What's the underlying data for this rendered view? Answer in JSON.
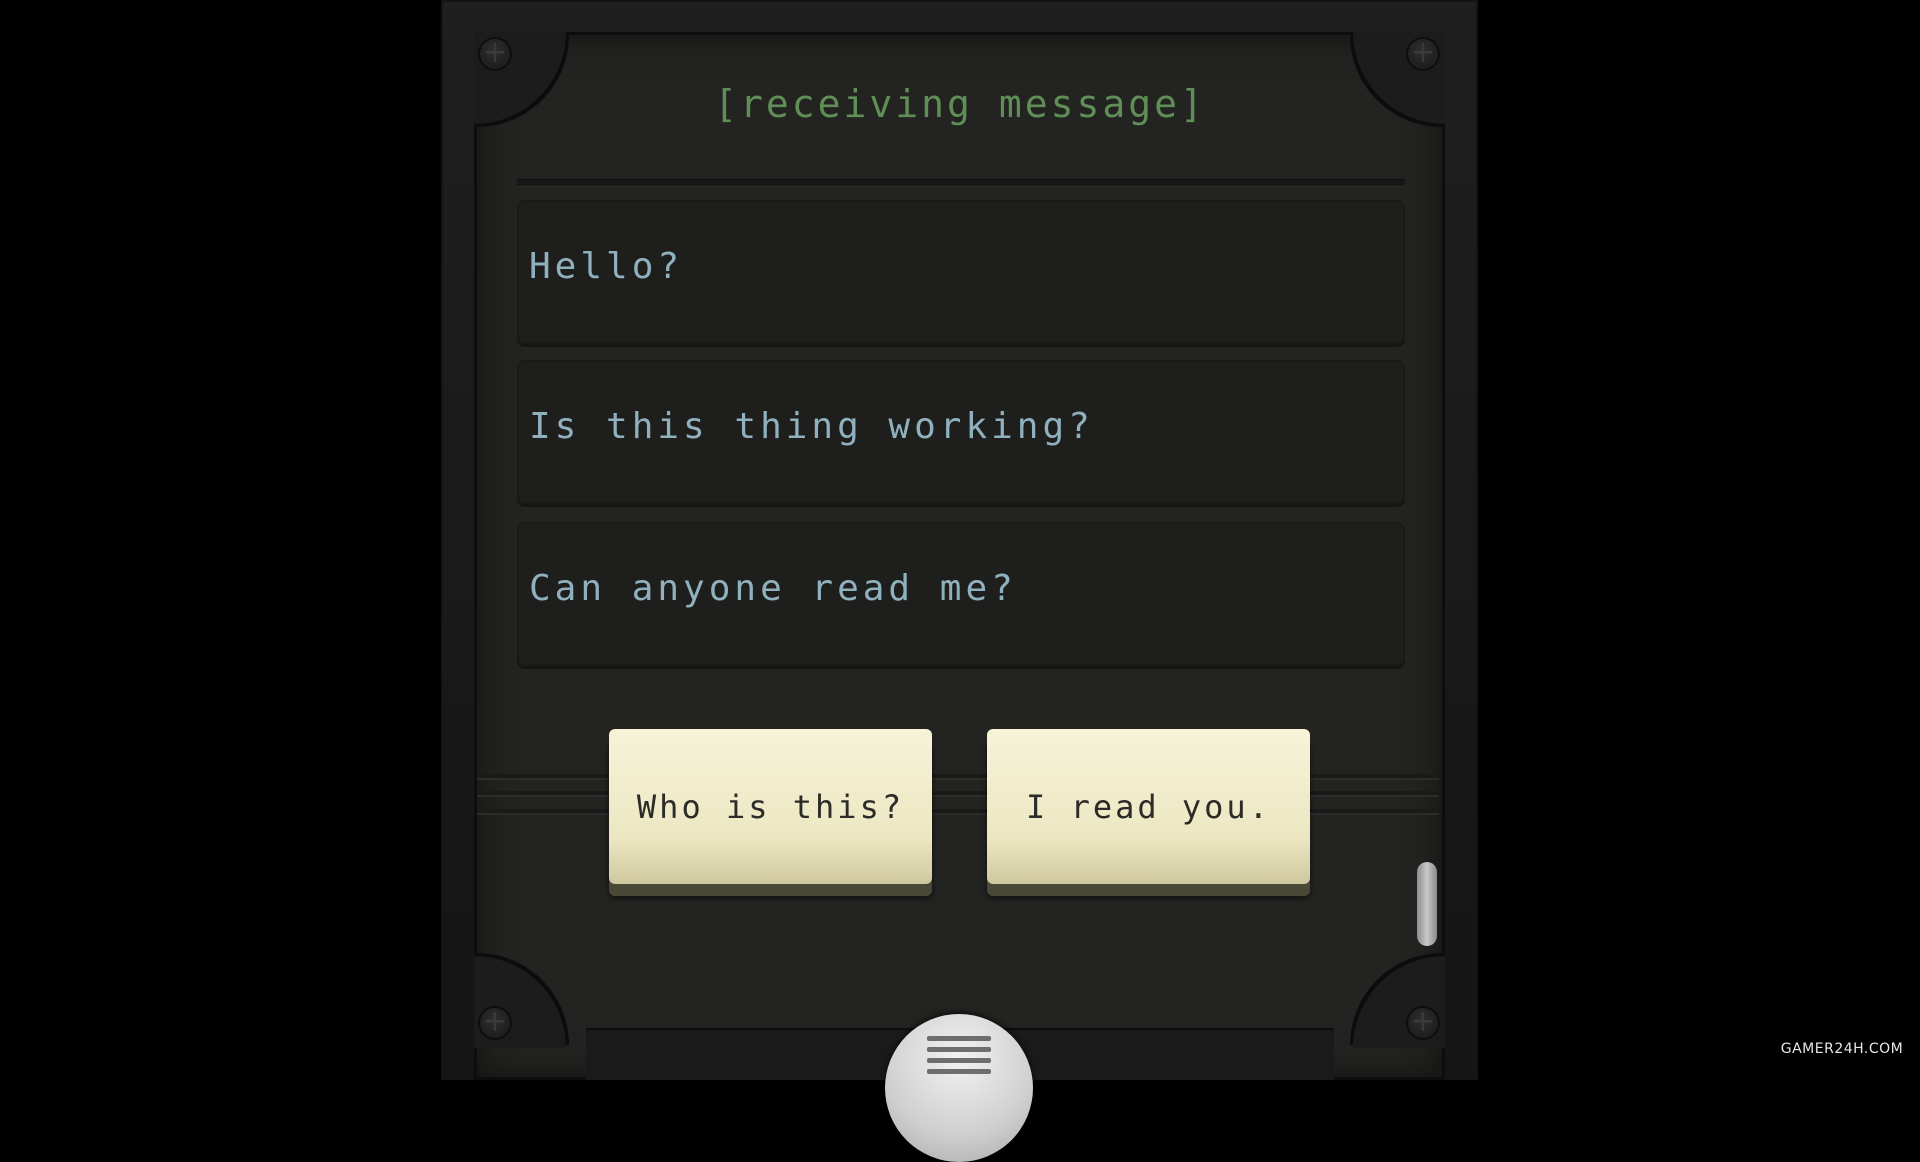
{
  "header": {
    "title": "[receiving message]"
  },
  "messages": [
    {
      "text": "Hello?"
    },
    {
      "text": "Is this thing working?"
    },
    {
      "text": "Can anyone read me?"
    }
  ],
  "choices": [
    {
      "label": "Who is this?"
    },
    {
      "label": "I read you."
    }
  ],
  "icons": {
    "screw": "plus",
    "menu": "hamburger-menu-icon"
  },
  "colors": {
    "header_text": "#5f8f57",
    "message_text": "#8fb0bd",
    "choice_button": "#ece7c2"
  },
  "watermark": "GAMER24H.COM"
}
